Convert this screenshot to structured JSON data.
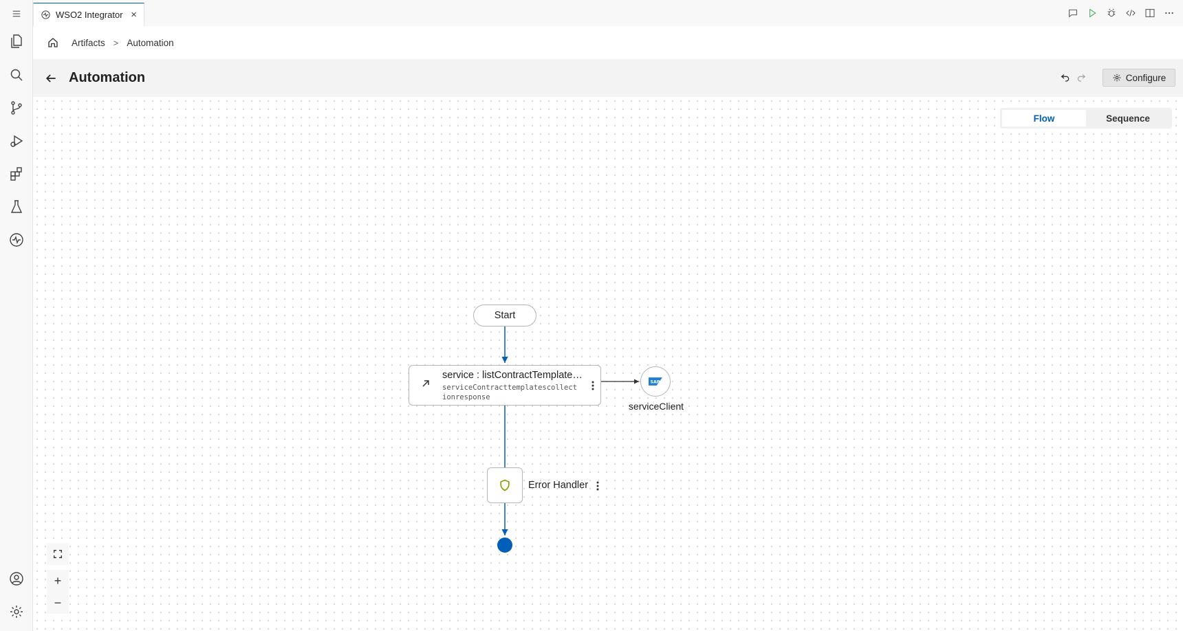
{
  "activity_bar": {
    "icons": [
      "menu-icon",
      "explorer-icon",
      "search-icon",
      "source-control-icon",
      "run-debug-icon",
      "extensions-icon",
      "testing-icon",
      "wso2-integrator-icon",
      "account-icon",
      "settings-icon"
    ]
  },
  "tab": {
    "title": "WSO2 Integrator",
    "close": "×"
  },
  "breadcrumb": {
    "items": [
      "Artifacts",
      "Automation"
    ],
    "separator": ">"
  },
  "header": {
    "title": "Automation",
    "configure_label": "Configure"
  },
  "view_toggle": {
    "active": "Flow",
    "inactive": "Sequence"
  },
  "zoom": {
    "plus": "+",
    "minus": "−"
  },
  "flow": {
    "start_label": "Start",
    "service_node": {
      "title": "service : listContractTemplatesCollection",
      "subtitle": "serviceContracttemplatescollectionresponse"
    },
    "client": {
      "label": "serviceClient",
      "badge": "SAP"
    },
    "error_handler": {
      "label": "Error Handler"
    }
  },
  "colors": {
    "accent": "#005fb8",
    "edge": "#005fb8",
    "shield": "#8a9a00"
  }
}
